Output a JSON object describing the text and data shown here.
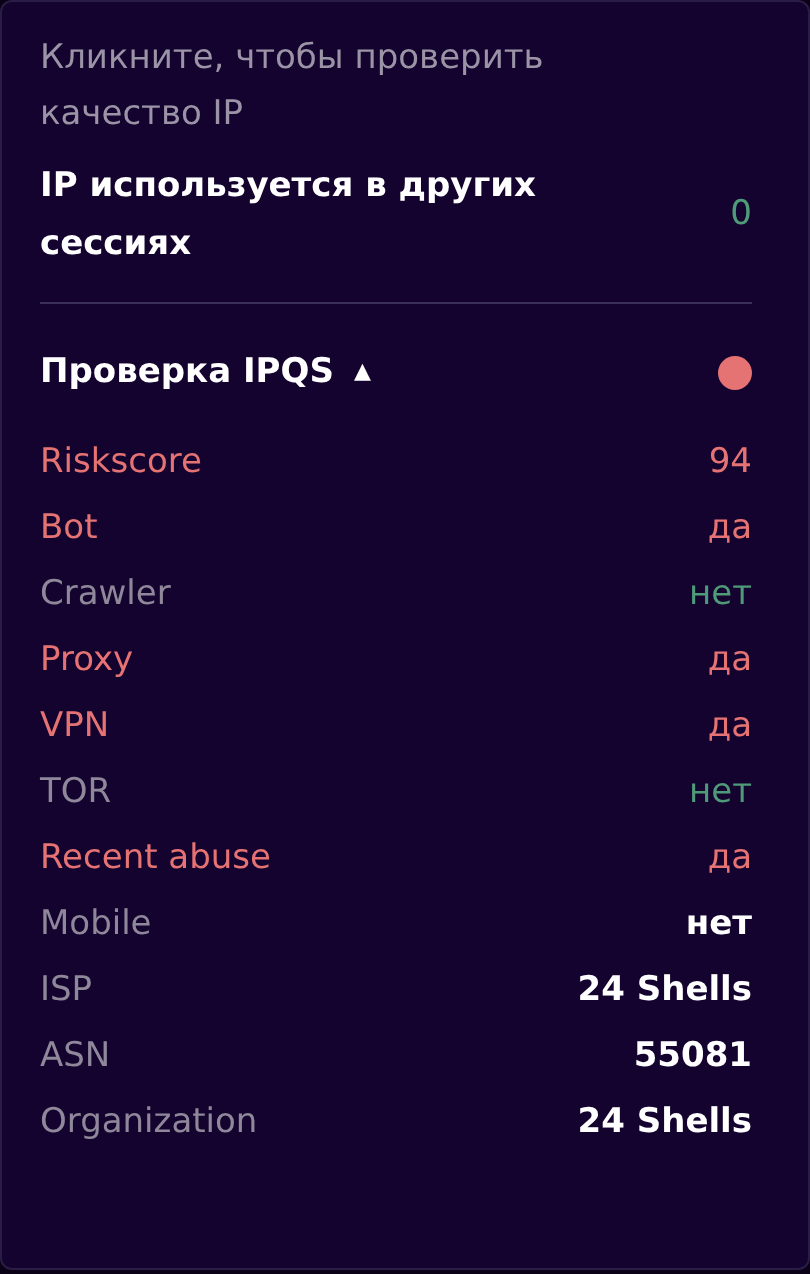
{
  "hint": "Кликните, чтобы проверить качество IP",
  "sessions": {
    "label": "IP используется в других сессиях",
    "value": "0"
  },
  "ipqs": {
    "title": "Проверка IPQS",
    "toggle": "▲",
    "risky": true,
    "rows": [
      {
        "label": "Riskscore",
        "value": "94",
        "kind": "danger"
      },
      {
        "label": "Bot",
        "value": "да",
        "kind": "danger"
      },
      {
        "label": "Crawler",
        "value": "нет",
        "kind": "safe"
      },
      {
        "label": "Proxy",
        "value": "да",
        "kind": "danger"
      },
      {
        "label": "VPN",
        "value": "да",
        "kind": "danger"
      },
      {
        "label": "TOR",
        "value": "нет",
        "kind": "safe"
      },
      {
        "label": "Recent abuse",
        "value": "да",
        "kind": "danger"
      },
      {
        "label": "Mobile",
        "value": "нет",
        "kind": "info"
      },
      {
        "label": "ISP",
        "value": "24 Shells",
        "kind": "info"
      },
      {
        "label": "ASN",
        "value": "55081",
        "kind": "info"
      },
      {
        "label": "Organization",
        "value": "24 Shells",
        "kind": "info"
      }
    ]
  }
}
